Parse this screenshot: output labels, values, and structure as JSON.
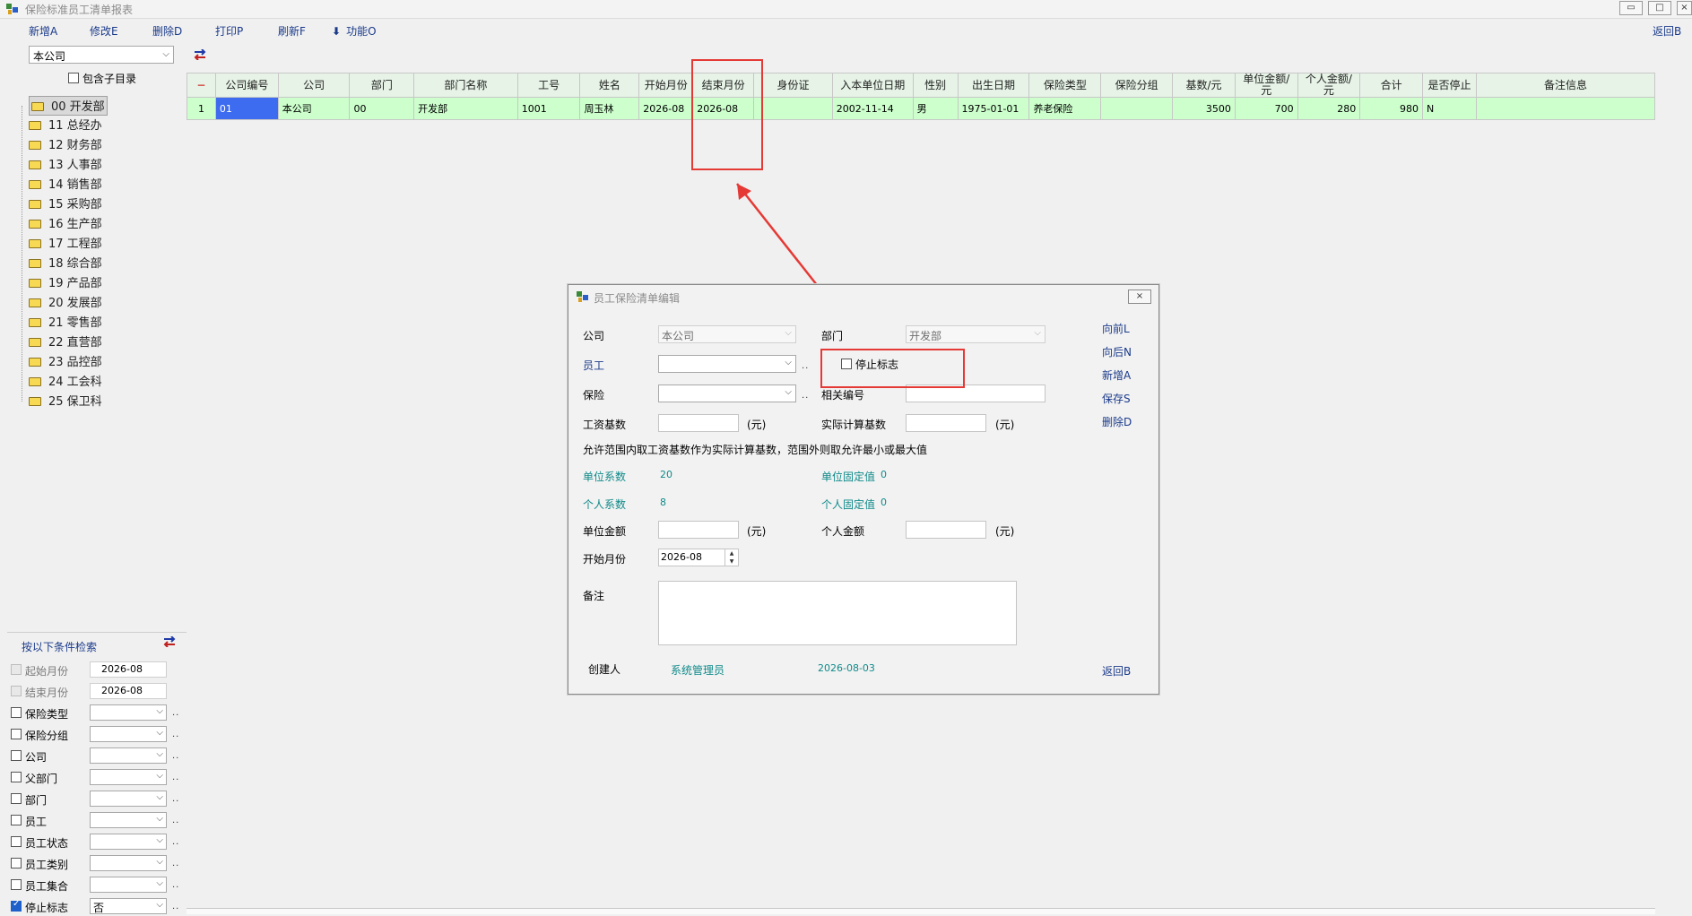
{
  "window": {
    "title": "保险标准员工清单报表",
    "btn_min": "▭",
    "btn_max": "□",
    "btn_close": "×"
  },
  "toolbar": {
    "add": "新增A",
    "edit": "修改E",
    "delete": "删除D",
    "print": "打印P",
    "refresh": "刷新F",
    "func": "功能O",
    "back": "返回B"
  },
  "company_select": {
    "value": "本公司"
  },
  "include_sub": {
    "label": "包含子目录"
  },
  "tree": [
    {
      "label": "00 开发部"
    },
    {
      "label": "11 总经办"
    },
    {
      "label": "12 财务部"
    },
    {
      "label": "13 人事部"
    },
    {
      "label": "14 销售部"
    },
    {
      "label": "15 采购部"
    },
    {
      "label": "16 生产部"
    },
    {
      "label": "17 工程部"
    },
    {
      "label": "18 综合部"
    },
    {
      "label": "19 产品部"
    },
    {
      "label": "20 发展部"
    },
    {
      "label": "21 零售部"
    },
    {
      "label": "22 直营部"
    },
    {
      "label": "23 品控部"
    },
    {
      "label": "24 工会科"
    },
    {
      "label": "25 保卫科"
    }
  ],
  "filter": {
    "title": "按以下条件检索",
    "rows": [
      {
        "label": "起始月份",
        "value": "2026-08"
      },
      {
        "label": "结束月份",
        "value": "2026-08"
      },
      {
        "label": "保险类型"
      },
      {
        "label": "保险分组"
      },
      {
        "label": "公司"
      },
      {
        "label": "父部门"
      },
      {
        "label": "部门"
      },
      {
        "label": "员工"
      },
      {
        "label": "员工状态"
      },
      {
        "label": "员工类别"
      },
      {
        "label": "员工集合"
      },
      {
        "label": "停止标志",
        "value": "否"
      }
    ]
  },
  "grid": {
    "corner": "−",
    "headers": [
      "公司编号",
      "公司",
      "部门",
      "部门名称",
      "工号",
      "姓名",
      "开始月份",
      "结束月份",
      "身份证",
      "入本单位日期",
      "性别",
      "出生日期",
      "保险类型",
      "保险分组",
      "基数/元",
      "单位金额/元",
      "个人金额/元",
      "合计",
      "是否停止",
      "备注信息"
    ],
    "rows": [
      {
        "rownum": "1",
        "cells": [
          "01",
          "本公司",
          "00",
          "开发部",
          "1001",
          "周玉林",
          "2026-08",
          "2026-08",
          "",
          "2002-11-14",
          "男",
          "1975-01-01",
          "养老保险",
          "",
          "3500",
          "700",
          "280",
          "980",
          "N",
          ""
        ]
      }
    ]
  },
  "dialog": {
    "title": "员工保险清单编辑",
    "close": "×",
    "company_label": "公司",
    "company_value": "本公司",
    "dept_label": "部门",
    "dept_value": "开发部",
    "employee_label": "员工",
    "insurance_label": "保险",
    "stop_label": "停止标志",
    "ref_label": "相关编号",
    "wage_label": "工资基数",
    "actual_label": "实际计算基数",
    "unit_yuan": "(元)",
    "note": "允许范围内取工资基数作为实际计算基数，范围外则取允许最小或最大值",
    "unit_coef_label": "单位系数",
    "unit_coef_value": "20",
    "unit_fixed_label": "单位固定值",
    "unit_fixed_value": "0",
    "pers_coef_label": "个人系数",
    "pers_coef_value": "8",
    "pers_fixed_label": "个人固定值",
    "pers_fixed_value": "0",
    "unit_amount_label": "单位金额",
    "pers_amount_label": "个人金额",
    "start_month_label": "开始月份",
    "start_month_value": "2026-08",
    "remark_label": "备注",
    "creator_label": "创建人",
    "creator_value": "系统管理员",
    "created_date": "2026-08-03",
    "side": {
      "prev": "向前L",
      "next": "向后N",
      "add": "新增A",
      "save": "保存S",
      "delete": "删除D",
      "back": "返回B"
    }
  },
  "colors": {
    "annotation": "#e53935",
    "row_bg": "#ccffcc",
    "selected_cell": "#3d6cf0",
    "link": "#1a3a8a"
  }
}
